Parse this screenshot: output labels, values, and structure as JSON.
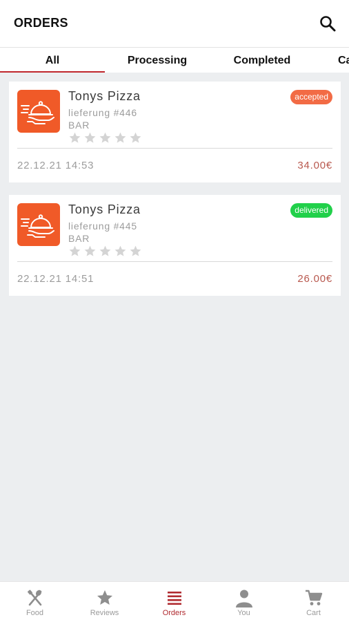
{
  "header": {
    "title": "ORDERS",
    "search_icon": "search-icon"
  },
  "tabs": [
    {
      "label": "All",
      "active": true
    },
    {
      "label": "Processing",
      "active": false
    },
    {
      "label": "Completed",
      "active": false
    },
    {
      "label": "Ca",
      "active": false
    }
  ],
  "orders": [
    {
      "store": "Tonys Pizza",
      "order_no": "lieferung #446",
      "type": "BAR",
      "status": "accepted",
      "status_color": "#f26b45",
      "rating": 0,
      "rating_max": 5,
      "datetime": "22.12.21 14:53",
      "amount": "34.00€",
      "icon": "food-delivery-icon"
    },
    {
      "store": "Tonys Pizza",
      "order_no": "lieferung #445",
      "type": "BAR",
      "status": "delivered",
      "status_color": "#21d04a",
      "rating": 0,
      "rating_max": 5,
      "datetime": "22.12.21 14:51",
      "amount": "26.00€",
      "icon": "food-delivery-icon"
    }
  ],
  "bottom_nav": [
    {
      "label": "Food",
      "icon": "fork-knife-icon",
      "active": false
    },
    {
      "label": "Reviews",
      "icon": "star-icon",
      "active": false
    },
    {
      "label": "Orders",
      "icon": "list-icon",
      "active": true
    },
    {
      "label": "You",
      "icon": "person-icon",
      "active": false
    },
    {
      "label": "Cart",
      "icon": "cart-icon",
      "active": false
    }
  ],
  "colors": {
    "accent": "#c0262c",
    "brand_orange": "#f05a28",
    "background": "#eceef0",
    "star_empty": "#d4d4d4",
    "nav_inactive": "#8e8e8e",
    "nav_active": "#b02a2f"
  }
}
